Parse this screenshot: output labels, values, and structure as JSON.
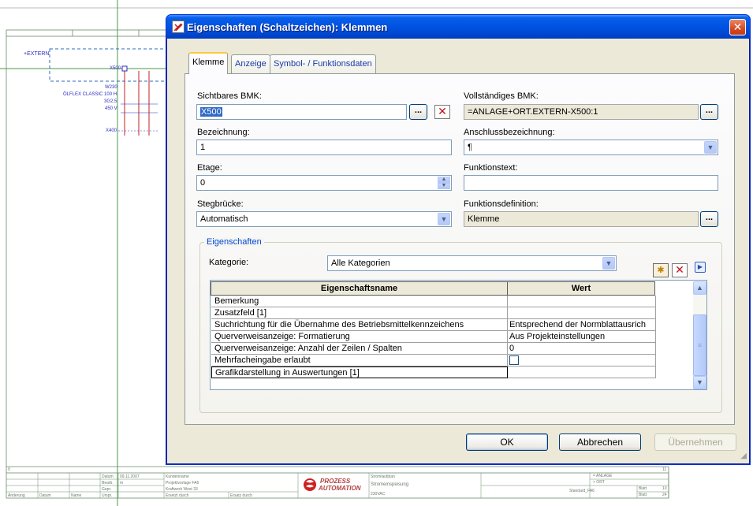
{
  "schematic": {
    "extern_label": "+EXTERN",
    "terminal_label": "X500",
    "cable_label_1": "W230",
    "cable_label_2": "ÖLFLEX CLASSIC 100 H",
    "cable_label_3": "3G2,5",
    "cable_label_4": "450 V",
    "terminal_label_2": "X400",
    "page_left": "9",
    "page_right": "11",
    "titleblock": {
      "datum_label": "Datum",
      "datum_value": "09.11.2007",
      "bearb_label": "Bearb.",
      "bearb_value": "m",
      "gepr_label": "Gepr.",
      "urspr_label": "Urspr.",
      "aenderung": "Änderung",
      "datum2": "Datum",
      "name": "Name",
      "customer": "Kundenname",
      "project_template": "Projektvorlage FA6",
      "plant": "Kraftwerk West 33",
      "ersetzt_durch": "Ersetzt durch",
      "ersatz_fuer": "Ersatz durch",
      "logo_line1": "PROZESS",
      "logo_line2": "AUTOMATION",
      "doc_line1": "Stromlaufplan",
      "doc_line2": "Stromeinspeisung",
      "doc_line3": "230VAC",
      "anlage": "= ANLAGE",
      "ort": "+ ORT",
      "standard": "Standard_FA6",
      "blatt1": "Blatt",
      "blatt1_val": "10",
      "blatt2": "Blatt",
      "blatt2_val": "24"
    }
  },
  "dialog": {
    "title": "Eigenschaften (Schaltzeichen): Klemmen",
    "tabs": [
      {
        "label": "Klemme"
      },
      {
        "label": "Anzeige"
      },
      {
        "label": "Symbol- / Funktionsdaten"
      }
    ],
    "fields": {
      "sichtbares_bmk_label": "Sichtbares BMK:",
      "sichtbares_bmk_value": "X500",
      "vollstaendiges_bmk_label": "Vollständiges BMK:",
      "vollstaendiges_bmk_value": "=ANLAGE+ORT.EXTERN-X500:1",
      "bezeichnung_label": "Bezeichnung:",
      "bezeichnung_value": "1",
      "anschluss_label": "Anschlussbezeichnung:",
      "anschluss_value": "¶",
      "etage_label": "Etage:",
      "etage_value": "0",
      "funktionstext_label": "Funktionstext:",
      "funktionstext_value": "",
      "stegbruecke_label": "Stegbrücke:",
      "stegbruecke_value": "Automatisch",
      "funktionsdefinition_label": "Funktionsdefinition:",
      "funktionsdefinition_value": "Klemme",
      "ellipsis": "..."
    },
    "properties": {
      "group_title": "Eigenschaften",
      "kategorie_label": "Kategorie:",
      "kategorie_value": "Alle Kategorien",
      "columns": [
        "Eigenschaftsname",
        "Wert"
      ],
      "rows": [
        {
          "name": "Bemerkung",
          "value": ""
        },
        {
          "name": "Zusatzfeld [1]",
          "value": ""
        },
        {
          "name": "Suchrichtung für die Übernahme des Betriebsmittelkennzeichens",
          "value": "Entsprechend der Normblattausrich"
        },
        {
          "name": "Querverweisanzeige: Formatierung",
          "value": "Aus Projekteinstellungen"
        },
        {
          "name": "Querverweisanzeige: Anzahl der Zeilen / Spalten",
          "value": "0"
        },
        {
          "name": "Mehrfacheingabe erlaubt",
          "value": ""
        },
        {
          "name": "Grafikdarstellung in Auswertungen [1]",
          "value": ""
        }
      ]
    },
    "buttons": {
      "ok": "OK",
      "cancel": "Abbrechen",
      "apply": "Übernehmen"
    }
  }
}
